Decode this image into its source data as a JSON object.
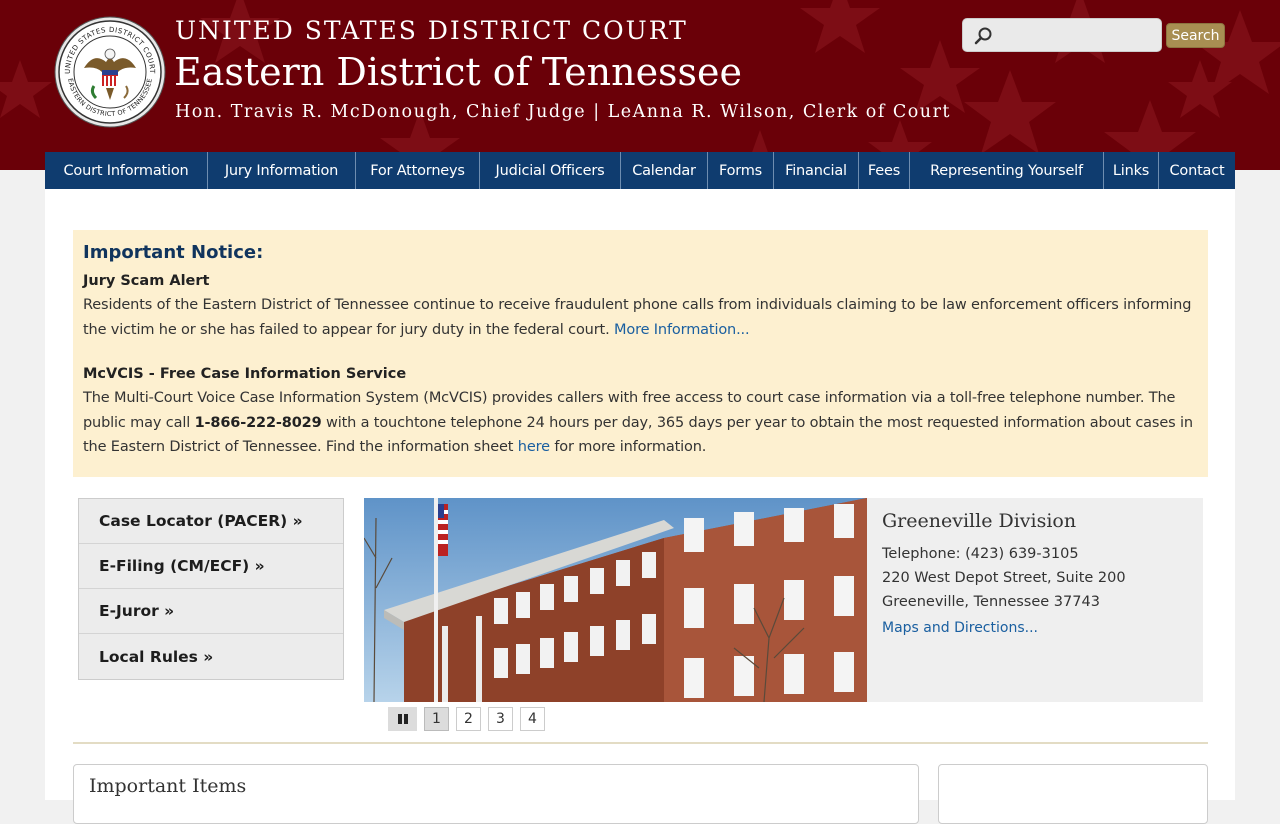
{
  "header": {
    "court": "UNITED STATES DISTRICT COURT",
    "district": "Eastern District of Tennessee",
    "officials": "Hon. Travis R. McDonough, Chief Judge | LeAnna R. Wilson, Clerk of Court",
    "seal_text_top": "UNITED STATES DISTRICT COURT",
    "seal_text_bottom": "EASTERN DISTRICT OF TENNESSEE"
  },
  "search": {
    "placeholder": "",
    "button_label": "Search",
    "icon": "search-icon"
  },
  "nav": [
    "Court Information",
    "Jury Information",
    "For Attorneys",
    "Judicial Officers",
    "Calendar",
    "Forms",
    "Financial",
    "Fees",
    "Representing Yourself",
    "Links",
    "Contact"
  ],
  "notice": {
    "title": "Important Notice:",
    "item1_title": "Jury Scam Alert",
    "item1_text": "Residents of the Eastern District of Tennessee continue to receive fraudulent phone calls from individuals claiming to be law enforcement officers informing the victim he or she has failed to appear for jury duty in the federal court.",
    "item1_link": "More Information...",
    "item2_title": "McVCIS - Free Case Information Service",
    "item2_text_a": "The Multi-Court Voice Case Information System (McVCIS) provides callers with free access to court case information via a toll-free telephone number. The public may call",
    "item2_phone": "1-866-222-8029",
    "item2_text_b": "with a touchtone telephone 24 hours per day, 365 days per year to obtain the most requested information about cases in the Eastern District of Tennessee. Find the information sheet",
    "item2_link": "here",
    "item2_text_c": "for more information."
  },
  "quick_links": [
    "Case Locator (PACER) »",
    "E-Filing (CM/ECF) »",
    "E-Juror »",
    "Local Rules »"
  ],
  "division": {
    "name": "Greeneville Division",
    "telephone": "Telephone:  (423) 639-3105",
    "address1": "220 West Depot Street, Suite 200",
    "address2": "Greeneville, Tennessee  37743",
    "maps_link": "Maps and Directions..."
  },
  "slideshow": {
    "pages": [
      "1",
      "2",
      "3",
      "4"
    ],
    "active_page": "1"
  },
  "panels": {
    "important_items_title": "Important Items"
  },
  "colors": {
    "header_bg": "#6a0008",
    "nav_bg": "#0f3c6f",
    "notice_bg": "#fdf0d0",
    "search_btn": "#a88e52",
    "link": "#1a5fa0"
  }
}
